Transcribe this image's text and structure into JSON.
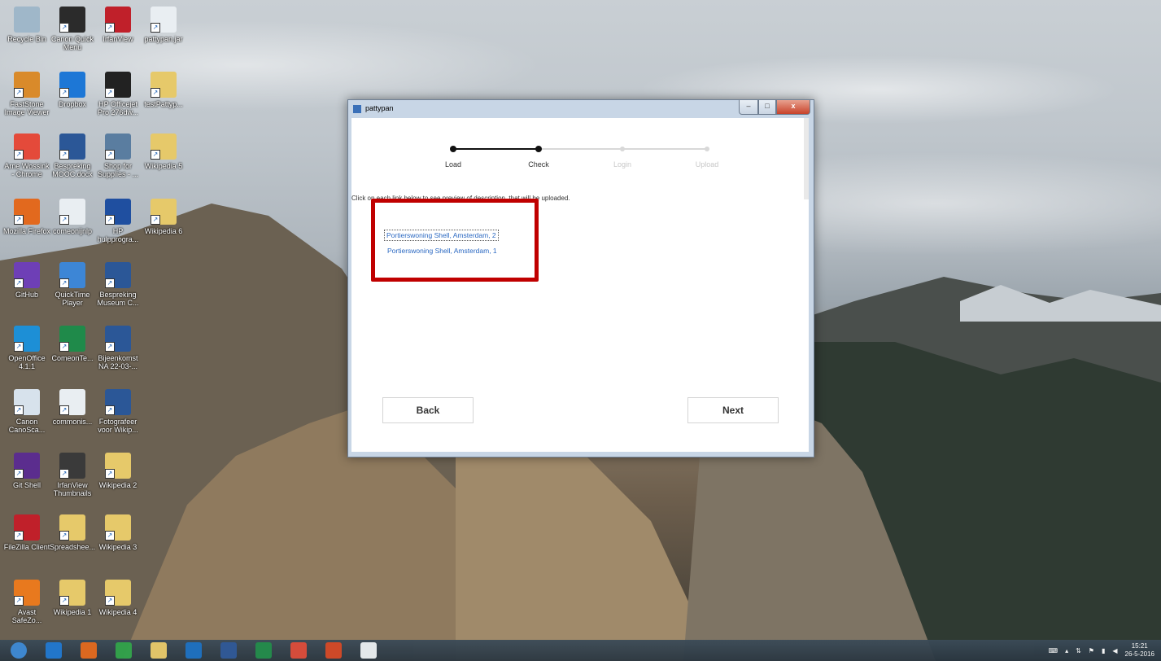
{
  "desktop_icons": [
    {
      "label": "Recycle Bin",
      "color": "#9fb7c9"
    },
    {
      "label": "Canon Quick Menu",
      "color": "#2b2b2b"
    },
    {
      "label": "IrfanView",
      "color": "#c0202a"
    },
    {
      "label": "pattypan.jar",
      "color": "#e9eef2"
    },
    {
      "label": "FastStone Image Viewer",
      "color": "#d98a2a"
    },
    {
      "label": "Dropbox",
      "color": "#1d77d6"
    },
    {
      "label": "HP Officejet Pro 276dw...",
      "color": "#222222"
    },
    {
      "label": "testPattyp...",
      "color": "#e6c96a"
    },
    {
      "label": "Arne Wossink - Chrome",
      "color": "#e44a3a"
    },
    {
      "label": "Bespreking MOOC.docx",
      "color": "#2b5797"
    },
    {
      "label": "Shop for Supplies - ...",
      "color": "#5a7da0"
    },
    {
      "label": "Wikipedia 5",
      "color": "#e6c96a"
    },
    {
      "label": "Mozilla Firefox",
      "color": "#e2691e"
    },
    {
      "label": "comeonijnlp",
      "color": "#e9eef2"
    },
    {
      "label": "HP hulpprogra...",
      "color": "#1f4fa0"
    },
    {
      "label": "Wikipedia 6",
      "color": "#e6c96a"
    },
    {
      "label": "GitHub",
      "color": "#6e3fb6"
    },
    {
      "label": "QuickTime Player",
      "color": "#3d86d6"
    },
    {
      "label": "Bespreking Museum C...",
      "color": "#2b5797"
    },
    {
      "label": "OpenOffice 4.1.1",
      "color": "#1d8fd6"
    },
    {
      "label": "ComeonTe...",
      "color": "#1f8a4a"
    },
    {
      "label": "Bijeenkomst NA 22-03-...",
      "color": "#2b5797"
    },
    {
      "label": "Canon CanoSca...",
      "color": "#d7e2ec"
    },
    {
      "label": "commonis...",
      "color": "#e9eef2"
    },
    {
      "label": "Fotografeer voor Wikip...",
      "color": "#2b5797"
    },
    {
      "label": "Git Shell",
      "color": "#5b2d8e"
    },
    {
      "label": "IrfanView Thumbnails",
      "color": "#3a3a3a"
    },
    {
      "label": "Wikipedia 2",
      "color": "#e6c96a"
    },
    {
      "label": "FileZilla Client",
      "color": "#c0202a"
    },
    {
      "label": "Spreadshee...",
      "color": "#e6c96a"
    },
    {
      "label": "Wikipedia 3",
      "color": "#e6c96a"
    },
    {
      "label": "Avast SafeZo...",
      "color": "#e8791e"
    },
    {
      "label": "Wikipedia 1",
      "color": "#e6c96a"
    },
    {
      "label": "Wikipedia 4",
      "color": "#e6c96a"
    }
  ],
  "window": {
    "title": "pattypan",
    "minimize_glyph": "–",
    "maximize_glyph": "□",
    "close_glyph": "x"
  },
  "steps": [
    {
      "label": "Load",
      "state": "done"
    },
    {
      "label": "Check",
      "state": "active"
    },
    {
      "label": "Login",
      "state": "pending"
    },
    {
      "label": "Upload",
      "state": "pending"
    }
  ],
  "instruction": "Click on each link below to see preview of description, that will be uploaded.",
  "links": [
    {
      "label": "Portierswoning Shell, Amsterdam, 2",
      "focused": true
    },
    {
      "label": "Portierswoning Shell, Amsterdam, 1",
      "focused": false
    }
  ],
  "buttons": {
    "back": "Back",
    "next": "Next"
  },
  "taskbar": {
    "apps": [
      {
        "name": "start-orb-icon",
        "color": "#3c8ad6"
      },
      {
        "name": "internet-explorer-icon",
        "color": "#1f78d1"
      },
      {
        "name": "firefox-icon",
        "color": "#e2691e"
      },
      {
        "name": "chrome-icon",
        "color": "#2fa34a"
      },
      {
        "name": "file-explorer-icon",
        "color": "#e6c96a"
      },
      {
        "name": "outlook-icon",
        "color": "#1a6fc2"
      },
      {
        "name": "word-icon",
        "color": "#2b5797"
      },
      {
        "name": "excel-icon",
        "color": "#1f8a4a"
      },
      {
        "name": "chrome-window-icon",
        "color": "#d94a3a"
      },
      {
        "name": "powerpoint-icon",
        "color": "#d24726"
      },
      {
        "name": "java-icon",
        "color": "#e9eef2"
      }
    ],
    "clock_time": "15:21",
    "clock_date": "26-5-2016"
  },
  "colors": {
    "accent_red": "#c00000",
    "link_blue": "#2a68c2",
    "step_done": "#111111",
    "step_pending": "#d5d5d5"
  }
}
